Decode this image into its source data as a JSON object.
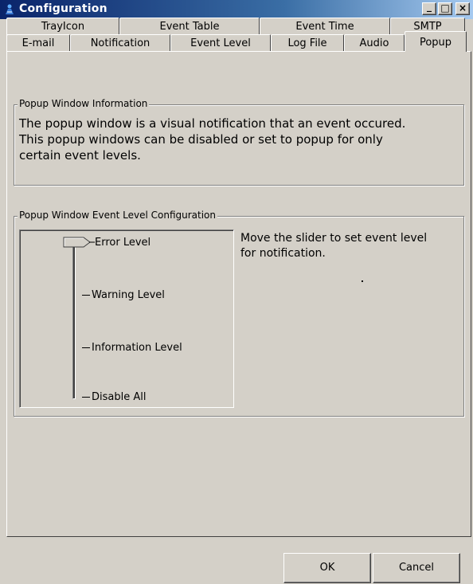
{
  "window": {
    "title": "Configuration",
    "minimize": "_",
    "maximize": "□",
    "close": "×"
  },
  "tabs_row1": [
    "TrayIcon",
    "Event Table",
    "Event Time",
    "SMTP"
  ],
  "tabs_row2": [
    "E-mail",
    "Notification",
    "Event Level",
    "Log File",
    "Audio",
    "Popup"
  ],
  "active_tab": "Popup",
  "popup_info": {
    "group_label": "Popup Window Information",
    "line1": "The popup window is a visual notification that an event occured.",
    "line2": "This popup windows can be disabled or set to popup for only",
    "line3": "certain event levels."
  },
  "event_level_config": {
    "group_label": "Popup Window Event Level Configuration",
    "levels": [
      "Error Level",
      "Warning Level",
      "Information Level",
      "Disable All"
    ],
    "selected_level": "Error Level",
    "hint_line1": "Move the slider to set event level",
    "hint_line2": "for notification."
  },
  "buttons": {
    "ok": "OK",
    "cancel": "Cancel"
  }
}
